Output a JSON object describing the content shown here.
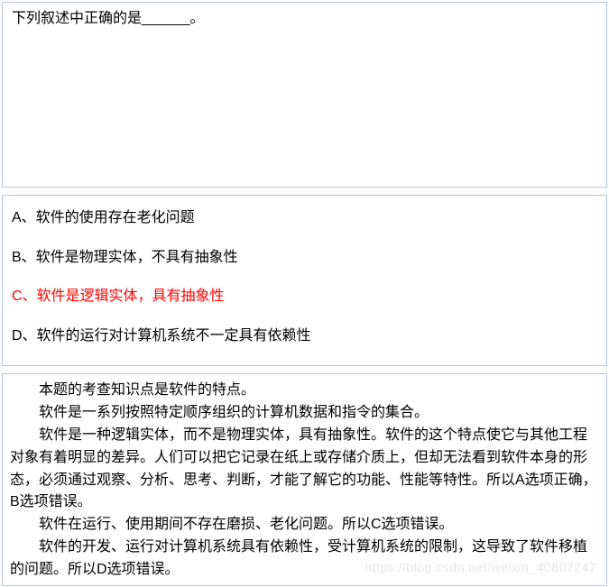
{
  "question": {
    "stem": "下列叙述中正确的是______。"
  },
  "options": {
    "a": "A、软件的使用存在老化问题",
    "b": "B、软件是物理实体，不具有抽象性",
    "c": "C、软件是逻辑实体，具有抽象性",
    "d": "D、软件的运行对计算机系统不一定具有依赖性"
  },
  "explanation": {
    "p1": "本题的考查知识点是软件的特点。",
    "p2": "软件是一系列按照特定顺序组织的计算机数据和指令的集合。",
    "p3": "软件是一种逻辑实体，而不是物理实体，具有抽象性。软件的这个特点使它与其他工程对象有着明显的差异。人们可以把它记录在纸上或存储介质上，但却无法看到软件本身的形态，必须通过观察、分析、思考、判断，才能了解它的功能、性能等特性。所以A选项正确，B选项错误。",
    "p4": "软件在运行、使用期间不存在磨损、老化问题。所以C选项错误。",
    "p5": "软件的开发、运行对计算机系统具有依赖性，受计算机系统的限制，这导致了软件移植的问题。所以D选项错误。"
  },
  "watermark": "https://blog.csdn.net/weixin_40807247"
}
